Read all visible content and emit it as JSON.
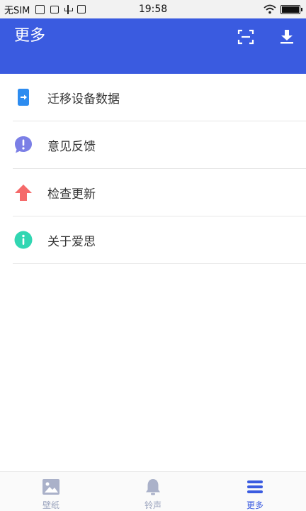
{
  "status_bar": {
    "carrier": "无SIM",
    "time": "19:58"
  },
  "header": {
    "title": "更多",
    "actions": [
      {
        "icon": "scan-icon"
      },
      {
        "icon": "download-icon"
      }
    ]
  },
  "menu": {
    "items": [
      {
        "label": "迁移设备数据",
        "icon": "migrate-icon",
        "color": "#2d8cf0"
      },
      {
        "label": "意见反馈",
        "icon": "feedback-icon",
        "color": "#7b7fe6"
      },
      {
        "label": "检查更新",
        "icon": "update-arrow-icon",
        "color": "#f56a6a"
      },
      {
        "label": "关于爱思",
        "icon": "info-icon",
        "color": "#31d6b2"
      }
    ]
  },
  "bottom_nav": {
    "items": [
      {
        "label": "壁纸",
        "icon": "wallpaper-icon",
        "active": false
      },
      {
        "label": "铃声",
        "icon": "bell-icon",
        "active": false
      },
      {
        "label": "更多",
        "icon": "more-icon",
        "active": true
      }
    ]
  },
  "colors": {
    "primary": "#3a5be0",
    "inactive": "#9aa3bd"
  }
}
